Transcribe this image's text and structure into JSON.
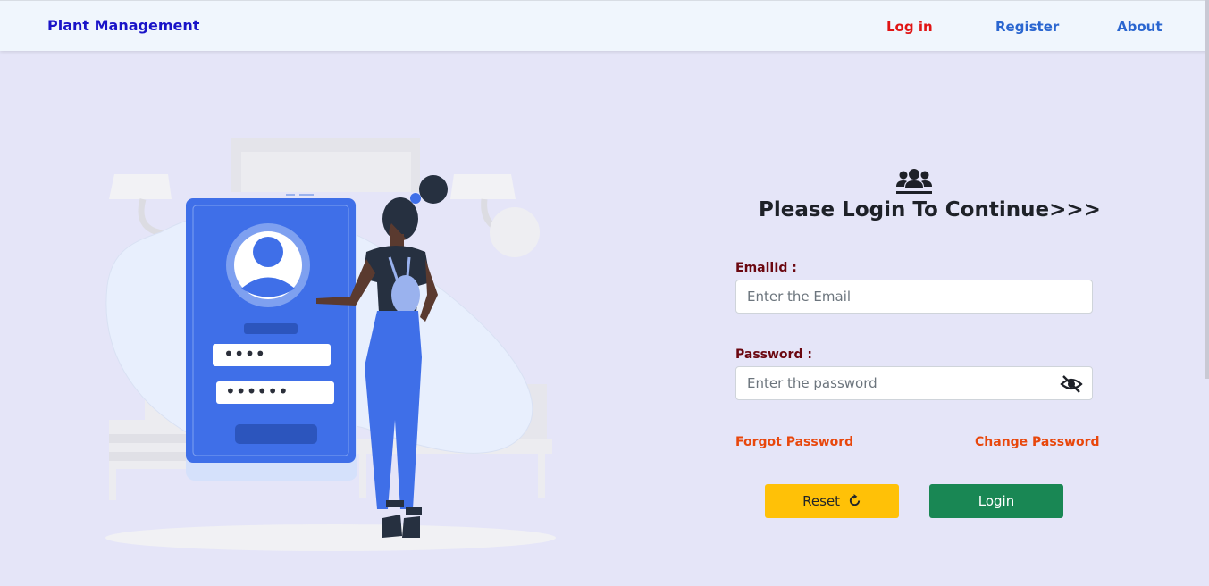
{
  "navbar": {
    "brand": "Plant Management",
    "links": {
      "login": "Log in",
      "register": "Register",
      "about": "About"
    }
  },
  "hero": {
    "image": "login-illustration",
    "masked_credentials": [
      "••••",
      "••••••"
    ]
  },
  "form": {
    "icon": "users-icon",
    "title": "Please Login To Continue>>>",
    "email": {
      "label": "EmailId :",
      "placeholder": "Enter the Email",
      "value": ""
    },
    "password": {
      "label": "Password :",
      "placeholder": "Enter the password",
      "value": "",
      "toggle_icon": "eye-slash-icon"
    },
    "forgot_password": "Forgot Password",
    "change_password": "Change Password",
    "reset_button": "Reset",
    "reset_icon": "refresh-icon",
    "login_button": "Login"
  },
  "colors": {
    "background": "#e5e5f8",
    "navbar_bg": "#f0f6fd",
    "brand": "#1a14c8",
    "nav_login": "#e01414",
    "nav_link": "#2a66d0",
    "label": "#6b0710",
    "link": "#e8470c",
    "reset_button": "#ffc107",
    "login_button": "#198754"
  }
}
